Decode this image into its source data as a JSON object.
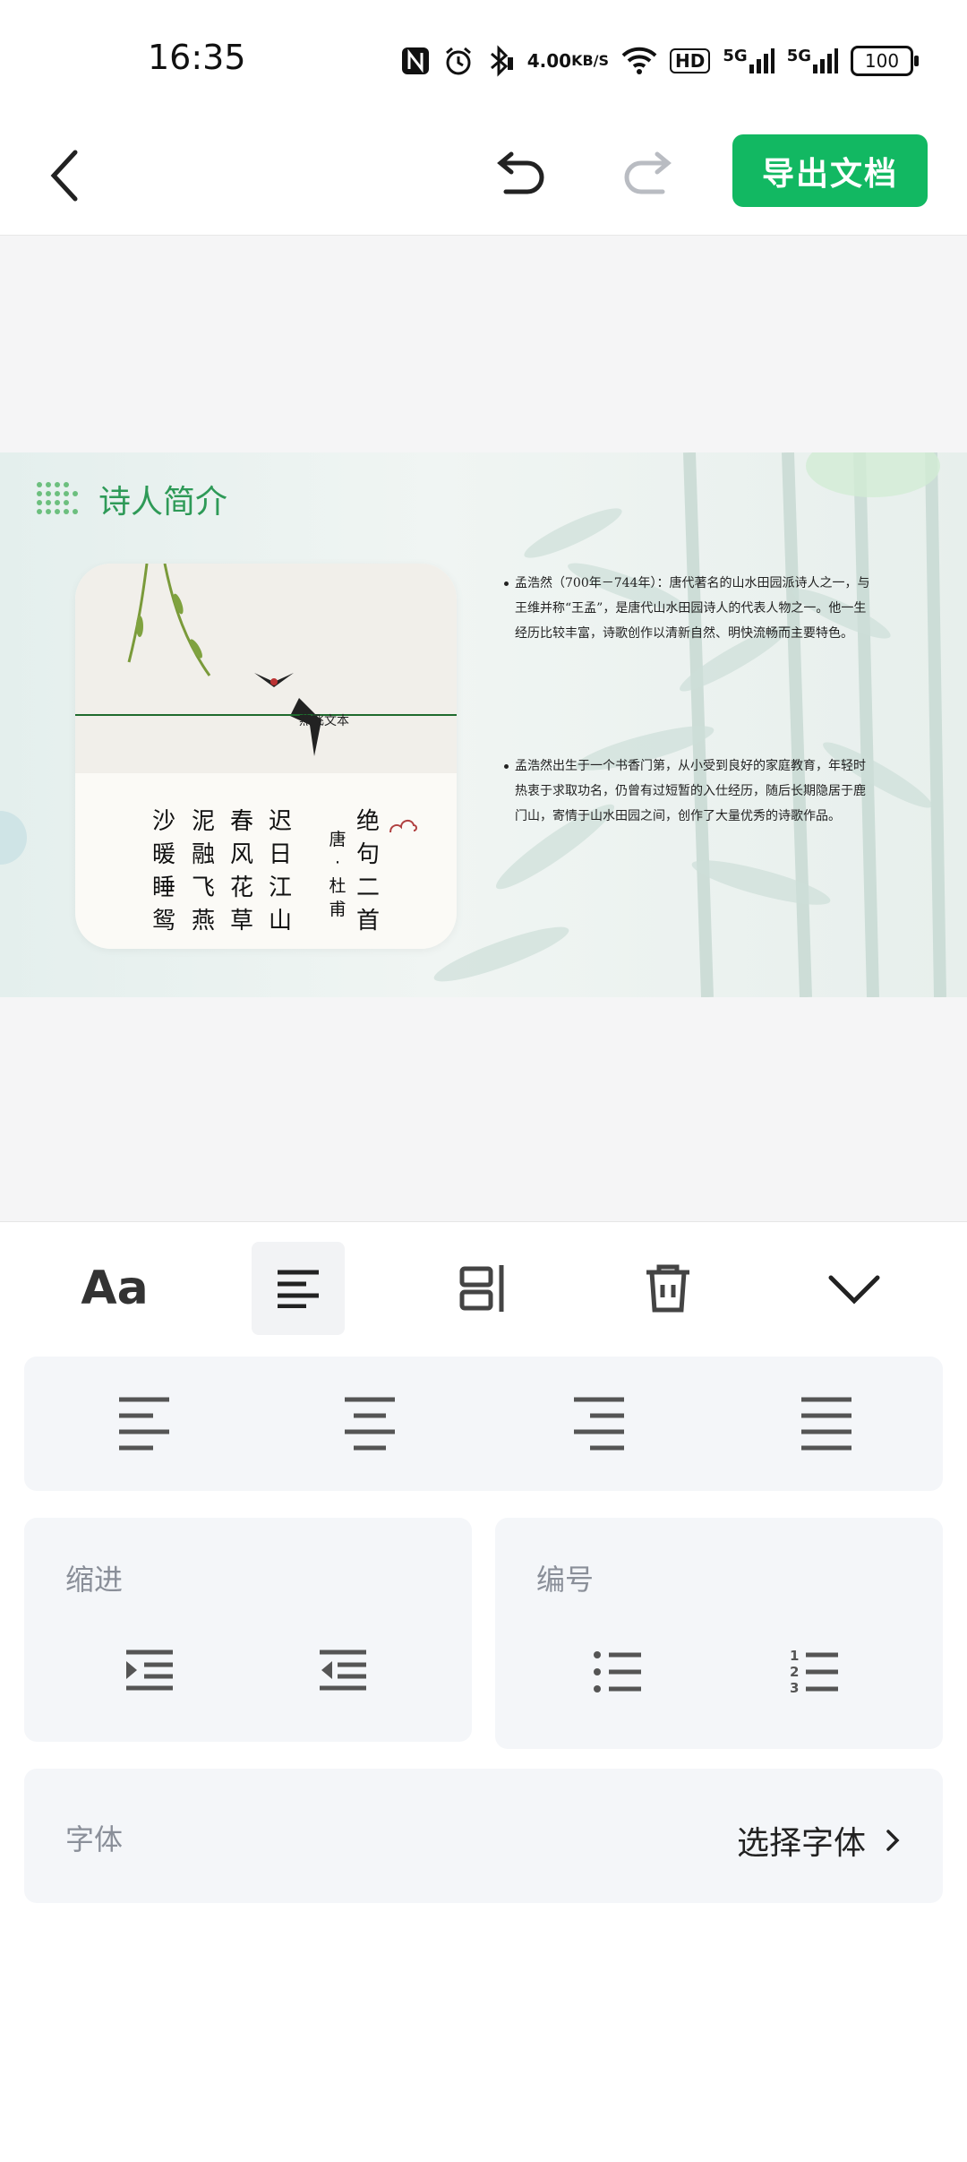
{
  "status_bar": {
    "time": "16:35",
    "net_speed_value": "4.00",
    "net_speed_unit": "KB/S",
    "hd_label": "HD",
    "signal1_label": "5G",
    "signal2_label": "5G",
    "battery": "100"
  },
  "toolbar": {
    "export_label": "导出文档",
    "icons": [
      "back-icon",
      "undo-icon",
      "redo-icon"
    ]
  },
  "slide": {
    "title": "诗人简介",
    "card_brand": "燕飞文本",
    "poem_title": [
      "绝",
      "句",
      "二",
      "首"
    ],
    "poem_author": [
      "唐",
      "·",
      "杜",
      "甫"
    ],
    "poem_columns": [
      [
        "迟",
        "日",
        "江",
        "山"
      ],
      [
        "春",
        "风",
        "花",
        "草"
      ],
      [
        "泥",
        "融",
        "飞",
        "燕"
      ],
      [
        "沙",
        "暖",
        "睡",
        "鸳"
      ]
    ],
    "paragraph1": "孟浩然（700年－744年）：唐代著名的山水田园派诗人之一，与王维并称“王孟”，是唐代山水田园诗人的代表人物之一。他一生经历比较丰富，诗歌创作以清新自然、明快流畅而主要特色。",
    "paragraph2": "孟浩然出生于一个书香门第，从小受到良好的家庭教育，年轻时热衷于求取功名，仍曾有过短暂的入仕经历，随后长期隐居于鹿门山，寄情于山水田园之间，创作了大量优秀的诗歌作品。",
    "colors": {
      "title": "#2e9a57",
      "accent": "#12b862"
    }
  },
  "panel": {
    "tab_font_label": "Aa",
    "tabs": [
      "font-tab",
      "paragraph-align-tab",
      "layout-tab",
      "delete-tab",
      "collapse-tab"
    ],
    "active_tab": "paragraph-align-tab",
    "alignment_options": [
      "align-left-icon",
      "align-center-icon",
      "align-right-icon",
      "align-justify-icon"
    ],
    "indent_label": "缩进",
    "numbering_label": "编号",
    "font_label": "字体",
    "font_select_label": "选择字体"
  }
}
